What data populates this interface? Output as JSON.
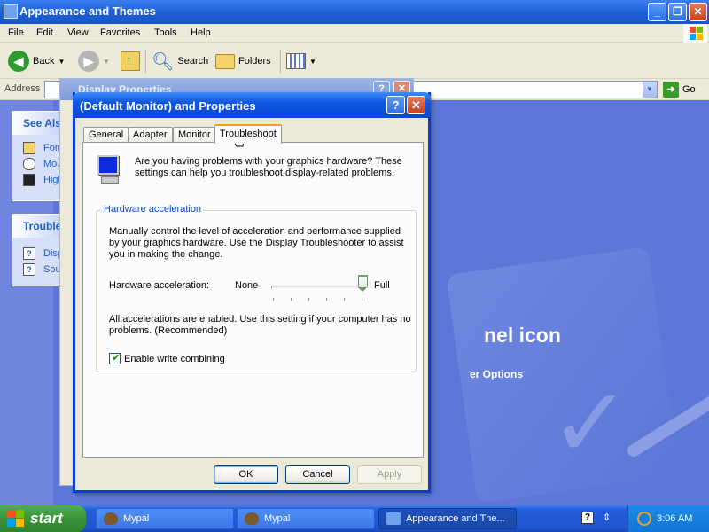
{
  "explorer": {
    "title": "Appearance and Themes",
    "menu": [
      "File",
      "Edit",
      "View",
      "Favorites",
      "Tools",
      "Help"
    ],
    "toolbar": {
      "back": "Back",
      "search": "Search",
      "folders": "Folders"
    },
    "address_label": "Address",
    "go_label": "Go",
    "background_text": {
      "panel_icon": "nel icon",
      "options": "er Options"
    },
    "see_also": {
      "title": "See Als",
      "items": [
        {
          "label": "Fon",
          "icon": "fonts-icon"
        },
        {
          "label": "Mou",
          "icon": "mouse-icon"
        },
        {
          "label": "High",
          "icon": "high-contrast-icon"
        }
      ]
    },
    "troubleshooters": {
      "title": "Trouble",
      "items": [
        {
          "label": "Disp",
          "icon": "help-icon"
        },
        {
          "label": "Sou",
          "icon": "help-icon"
        }
      ]
    }
  },
  "display_properties": {
    "title": "Display Properties"
  },
  "dialog": {
    "title": "(Default Monitor) and  Properties",
    "tabs": [
      "General",
      "Adapter",
      "Monitor",
      "Troubleshoot"
    ],
    "active_tab": "Troubleshoot",
    "intro": "Are you having problems with your graphics hardware? These settings can help you troubleshoot display-related problems.",
    "group_title": "Hardware acceleration",
    "group_desc": "Manually control the level of acceleration and performance supplied by your graphics hardware. Use the Display Troubleshooter to assist you in making the change.",
    "slider_label": "Hardware acceleration:",
    "slider_min": "None",
    "slider_max": "Full",
    "slider_level": 1.0,
    "slider_steps": 6,
    "status": "All accelerations are enabled. Use this setting if your computer has no problems. (Recommended)",
    "write_combining_label": "Enable write combining",
    "write_combining_checked": true,
    "buttons": {
      "ok": "OK",
      "cancel": "Cancel",
      "apply": "Apply"
    }
  },
  "taskbar": {
    "start": "start",
    "tasks": [
      {
        "label": "Mypal",
        "icon": "mypal-icon",
        "active": false
      },
      {
        "label": "Mypal",
        "icon": "mypal-icon",
        "active": false
      },
      {
        "label": "Appearance and The...",
        "icon": "folder-icon",
        "active": true
      }
    ],
    "clock": "3:06 AM"
  },
  "colors": {
    "title_blue": "#0b48d3",
    "accent_orange": "#ff9a1a",
    "start_green": "#3a943a"
  }
}
